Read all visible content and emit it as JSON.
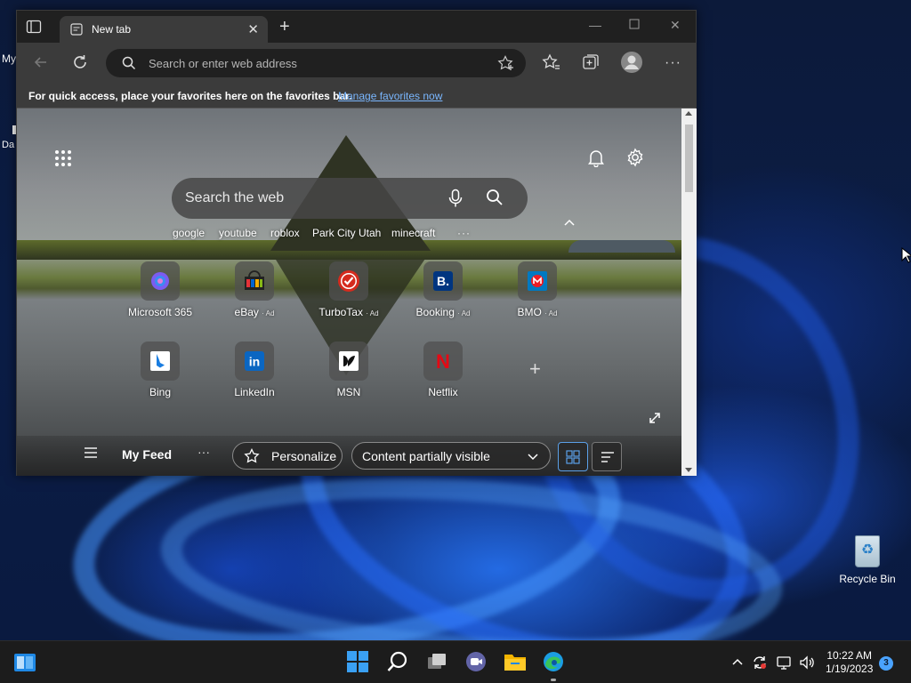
{
  "desktop": {
    "recycle_bin_label": "Recycle Bin",
    "left_fragments": [
      "My",
      "Da"
    ]
  },
  "browser": {
    "tab": {
      "title": "New tab"
    },
    "addressbar": {
      "placeholder": "Search or enter web address"
    },
    "favorites_bar": {
      "message": "For quick access, place your favorites here on the favorites bar.",
      "link": "Manage favorites now"
    },
    "ntp": {
      "search_placeholder": "Search the web",
      "quick_searches": [
        "google",
        "youtube",
        "roblox",
        "Park City Utah",
        "minecraft"
      ],
      "tiles": [
        {
          "label": "Microsoft 365",
          "ad": ""
        },
        {
          "label": "eBay",
          "ad": "Ad"
        },
        {
          "label": "TurboTax",
          "ad": "Ad"
        },
        {
          "label": "Booking",
          "ad": "Ad"
        },
        {
          "label": "BMO",
          "ad": "Ad"
        },
        {
          "label": "Bing",
          "ad": ""
        },
        {
          "label": "LinkedIn",
          "ad": ""
        },
        {
          "label": "MSN",
          "ad": ""
        },
        {
          "label": "Netflix",
          "ad": ""
        }
      ],
      "feed": {
        "title": "My Feed",
        "personalize": "Personalize",
        "content_visibility": "Content partially visible"
      }
    }
  },
  "taskbar": {
    "time": "10:22 AM",
    "date": "1/19/2023",
    "notification_count": "3"
  },
  "icons": [
    "tab-actions-icon",
    "page-icon",
    "close-icon",
    "plus-icon",
    "minimize-icon",
    "maximize-icon",
    "back-icon",
    "refresh-icon",
    "search-icon",
    "add-favorite-icon",
    "favorites-icon",
    "collections-icon",
    "profile-icon",
    "more-icon",
    "apps-grid-icon",
    "bell-icon",
    "gear-icon",
    "mic-icon",
    "chevron-up-icon",
    "expand-icon",
    "hamburger-icon",
    "star-icon",
    "chevron-down-icon",
    "grid-view-icon",
    "list-view-icon",
    "windows-start-icon",
    "taskview-icon",
    "teams-icon",
    "file-explorer-icon",
    "edge-icon",
    "widgets-icon",
    "network-icon",
    "volume-icon",
    "recycle-bin-icon"
  ],
  "colors": {
    "accent_link": "#7ab7ff",
    "taskbar": "#1c1c1c",
    "browser_chrome": "#3b3b3b",
    "notification_badge": "#4aa3ff"
  }
}
